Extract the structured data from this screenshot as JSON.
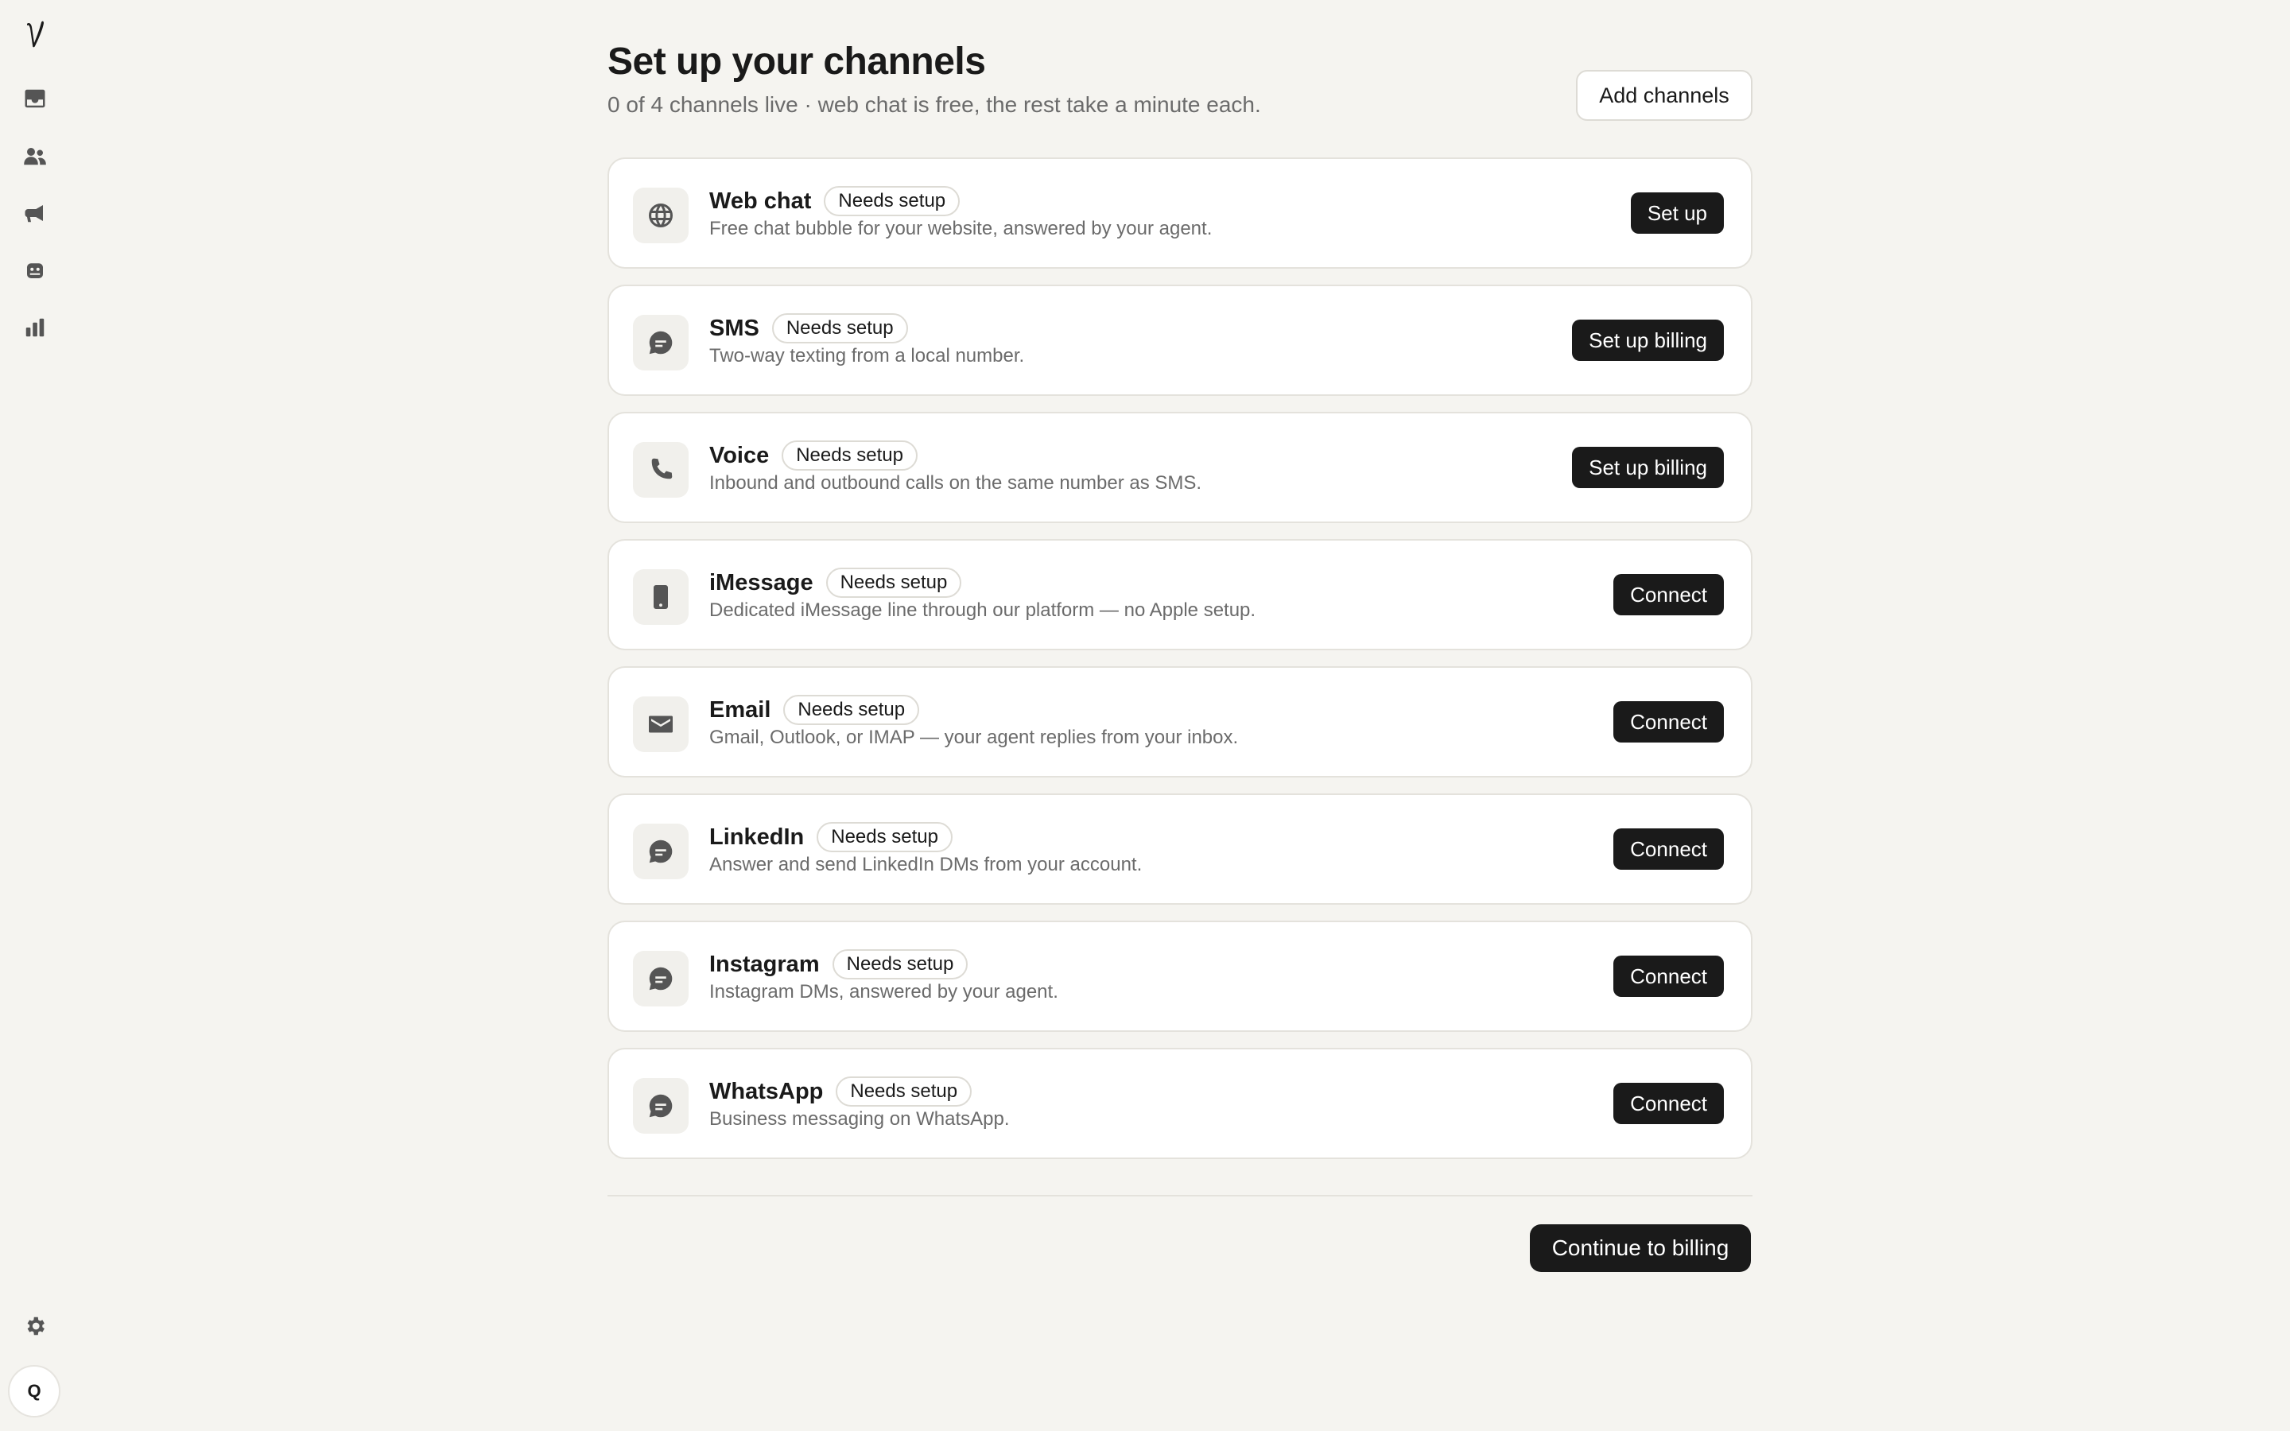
{
  "app": {
    "logo_icon": "logo-icon",
    "accent": "#1a1a1a",
    "background": "#f5f4f0"
  },
  "sidebar": {
    "items": [
      {
        "icon": "inbox-icon"
      },
      {
        "icon": "contacts-icon"
      },
      {
        "icon": "megaphone-icon"
      },
      {
        "icon": "agent-icon"
      },
      {
        "icon": "analytics-icon"
      }
    ],
    "settings_icon": "gear-icon",
    "avatar_initial": "Q"
  },
  "header": {
    "title": "Set up your channels",
    "subtitle": "0 of 4 channels live · web chat is free, the rest take a minute each.",
    "add_channels_label": "Add channels"
  },
  "channels": [
    {
      "name": "Web chat",
      "badge": "Needs setup",
      "description": "Free chat bubble for your website, answered by your agent.",
      "action": "Set up",
      "icon": "globe-icon"
    },
    {
      "name": "SMS",
      "badge": "Needs setup",
      "description": "Two-way texting from a local number.",
      "action": "Set up billing",
      "icon": "chat-bubble-icon"
    },
    {
      "name": "Voice",
      "badge": "Needs setup",
      "description": "Inbound and outbound calls on the same number as SMS.",
      "action": "Set up billing",
      "icon": "phone-icon"
    },
    {
      "name": "iMessage",
      "badge": "Needs setup",
      "description": "Dedicated iMessage line through our platform — no Apple setup.",
      "action": "Connect",
      "icon": "mobile-phone-icon"
    },
    {
      "name": "Email",
      "badge": "Needs setup",
      "description": "Gmail, Outlook, or IMAP — your agent replies from your inbox.",
      "action": "Connect",
      "icon": "envelope-icon"
    },
    {
      "name": "LinkedIn",
      "badge": "Needs setup",
      "description": "Answer and send LinkedIn DMs from your account.",
      "action": "Connect",
      "icon": "chat-bubble-icon"
    },
    {
      "name": "Instagram",
      "badge": "Needs setup",
      "description": "Instagram DMs, answered by your agent.",
      "action": "Connect",
      "icon": "chat-bubble-icon"
    },
    {
      "name": "WhatsApp",
      "badge": "Needs setup",
      "description": "Business messaging on WhatsApp.",
      "action": "Connect",
      "icon": "chat-bubble-icon"
    }
  ],
  "footer": {
    "continue_label": "Continue to billing"
  }
}
